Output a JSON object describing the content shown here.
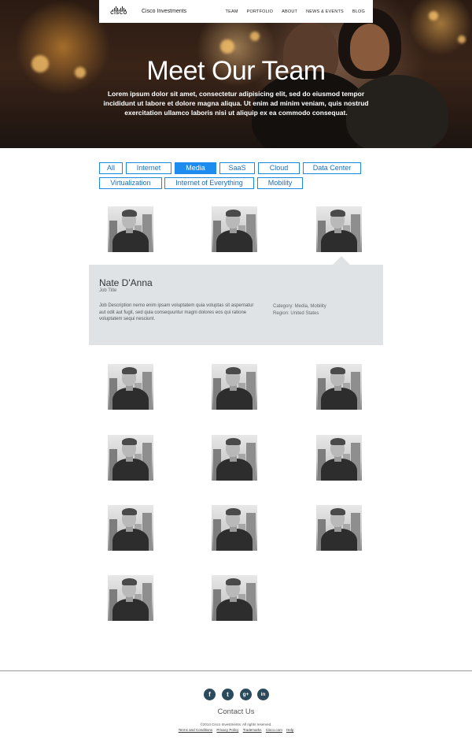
{
  "brand": {
    "logo_text": "CISCO",
    "name": "Cisco Investments"
  },
  "nav": {
    "items": [
      "TEAM",
      "PORTFOLIO",
      "ABOUT",
      "NEWS & EVENTS",
      "BLOG"
    ]
  },
  "hero": {
    "title": "Meet Our Team",
    "subtitle": "Lorem ipsum dolor sit amet, consectetur adipisicing elit, sed do eiusmod tempor incididunt ut labore et dolore magna aliqua. Ut enim ad minim veniam, quis nostrud exercitation ullamco laboris nisi ut aliquip ex ea commodo consequat."
  },
  "filters": {
    "items": [
      "All",
      "Internet",
      "Media",
      "SaaS",
      "Cloud",
      "Data Center",
      "Virtualization",
      "Internet of Everything",
      "Mobility"
    ],
    "active": "Media"
  },
  "detail": {
    "name": "Nate D'Anna",
    "job_title": "Job Title",
    "description": "Job Description nemo enim ipsam voluptatem quia voluptas sit aspernatur aut odit aut fugit, sed quia consequuntur magni dolores eos qui ratione voluptatem sequi nesciunt.",
    "category": "Category: Media, Mobility",
    "region": "Region: United States"
  },
  "footer": {
    "social": [
      {
        "name": "facebook-icon",
        "glyph": "f"
      },
      {
        "name": "twitter-icon",
        "glyph": "t"
      },
      {
        "name": "google-plus-icon",
        "glyph": "g+"
      },
      {
        "name": "linkedin-icon",
        "glyph": "in"
      }
    ],
    "contact": "Contact Us",
    "copyright": "©2014 Cisco Investments. All rights reserved.",
    "links": [
      "Terms and Conditions",
      "Privacy Policy",
      "Trademarks",
      "Cisco.com",
      "Help"
    ]
  },
  "colors": {
    "accent": "#1e8cef",
    "panel": "#dfe3e6",
    "social_bg": "#2c4a5e"
  }
}
